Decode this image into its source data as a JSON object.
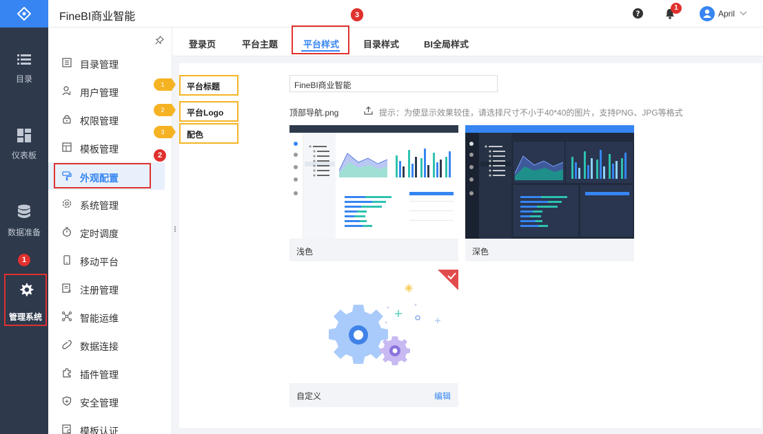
{
  "app": {
    "title": "FineBI商业智能"
  },
  "rail": {
    "items": [
      {
        "label": "目录",
        "icon": "list-icon"
      },
      {
        "label": "仪表板",
        "icon": "dashboard-icon"
      },
      {
        "label": "数据准备",
        "icon": "database-icon"
      },
      {
        "label": "管理系统",
        "icon": "gear-icon",
        "active": true
      }
    ],
    "badge": "1"
  },
  "topbar": {
    "user": "April",
    "notif_count": "1"
  },
  "sidebar": {
    "items": [
      {
        "label": "目录管理"
      },
      {
        "label": "用户管理"
      },
      {
        "label": "权限管理"
      },
      {
        "label": "模板管理"
      },
      {
        "label": "外观配置",
        "active": true
      },
      {
        "label": "系统管理"
      },
      {
        "label": "定时调度"
      },
      {
        "label": "移动平台"
      },
      {
        "label": "注册管理"
      },
      {
        "label": "智能运维"
      },
      {
        "label": "数据连接"
      },
      {
        "label": "插件管理"
      },
      {
        "label": "安全管理"
      },
      {
        "label": "模板认证"
      }
    ],
    "badge": "2"
  },
  "tabs": {
    "items": [
      {
        "label": "登录页"
      },
      {
        "label": "平台主题"
      },
      {
        "label": "平台样式",
        "active": true
      },
      {
        "label": "目录样式"
      },
      {
        "label": "BI全局样式"
      }
    ],
    "badge": "3"
  },
  "content": {
    "labels": [
      {
        "text": "平台标题",
        "num": "1"
      },
      {
        "text": "平台Logo",
        "num": "2"
      },
      {
        "text": "配色",
        "num": "3"
      }
    ],
    "title_value": "FineBI商业智能",
    "logo_file": "顶部导航.png",
    "logo_hint": "提示：为使显示效果较佳，请选择尺寸不小于40*40的图片，支持PNG、JPG等格式",
    "themes": [
      {
        "name": "浅色"
      },
      {
        "name": "深色"
      },
      {
        "name": "自定义",
        "action": "编辑"
      }
    ]
  },
  "colors": {
    "accent": "#3685f2",
    "rail": "#2e394c",
    "highlight_red": "#e0312e",
    "callout": "#f5b324"
  }
}
